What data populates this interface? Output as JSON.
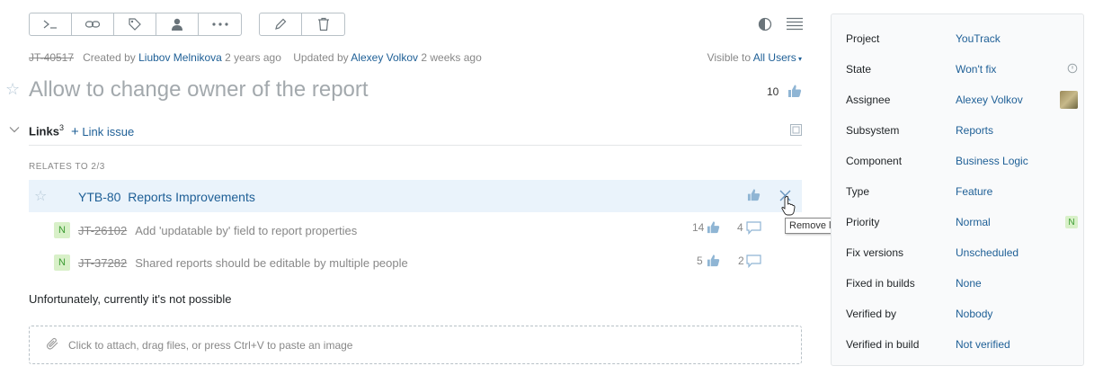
{
  "colors": {
    "link": "#1e5f96",
    "muted": "#888888",
    "highlight_row": "#eaf3fb",
    "badge_bg": "#d8f0c8",
    "badge_fg": "#3c9c34"
  },
  "toolbar": {
    "group1": [
      "console-icon",
      "link-icon",
      "tag-icon",
      "user-icon",
      "more-icon"
    ],
    "group2": [
      "pencil-icon",
      "trash-icon"
    ]
  },
  "meta": {
    "issue_id": "JT-40517",
    "created_prefix": "Created by",
    "creator": "Liubov Melnikova",
    "created_ago": "2 years ago",
    "updated_prefix": "Updated by",
    "updater": "Alexey Volkov",
    "updated_ago": "2 weeks ago"
  },
  "visibility": {
    "prefix": "Visible to",
    "value": "All Users"
  },
  "issue": {
    "title": "Allow to change owner of the report",
    "votes": "10"
  },
  "links": {
    "heading": "Links",
    "count": "3",
    "add_label": "Link issue",
    "group_label": "RELATES TO 2/3",
    "main": {
      "id": "YTB-80",
      "summary": "Reports Improvements"
    },
    "children": [
      {
        "badge": "N",
        "id": "JT-26102",
        "summary": "Add 'updatable by' field to report properties",
        "votes": "14",
        "comments": "4"
      },
      {
        "badge": "N",
        "id": "JT-37282",
        "summary": "Shared reports should be editable by multiple people",
        "votes": "5",
        "comments": "2"
      }
    ],
    "tooltip": "Remove link"
  },
  "comment_text": "Unfortunately, currently it's not possible",
  "attach_placeholder": "Click to attach, drag files, or press Ctrl+V to paste an image",
  "fields": [
    {
      "name": "Project",
      "value": "YouTrack"
    },
    {
      "name": "State",
      "value": "Won't fix"
    },
    {
      "name": "Assignee",
      "value": "Alexey Volkov"
    },
    {
      "name": "Subsystem",
      "value": "Reports"
    },
    {
      "name": "Component",
      "value": "Business Logic"
    },
    {
      "name": "Type",
      "value": "Feature"
    },
    {
      "name": "Priority",
      "value": "Normal",
      "badge": "N"
    },
    {
      "name": "Fix versions",
      "value": "Unscheduled"
    },
    {
      "name": "Fixed in builds",
      "value": "None"
    },
    {
      "name": "Verified by",
      "value": "Nobody"
    },
    {
      "name": "Verified in build",
      "value": "Not verified"
    }
  ]
}
